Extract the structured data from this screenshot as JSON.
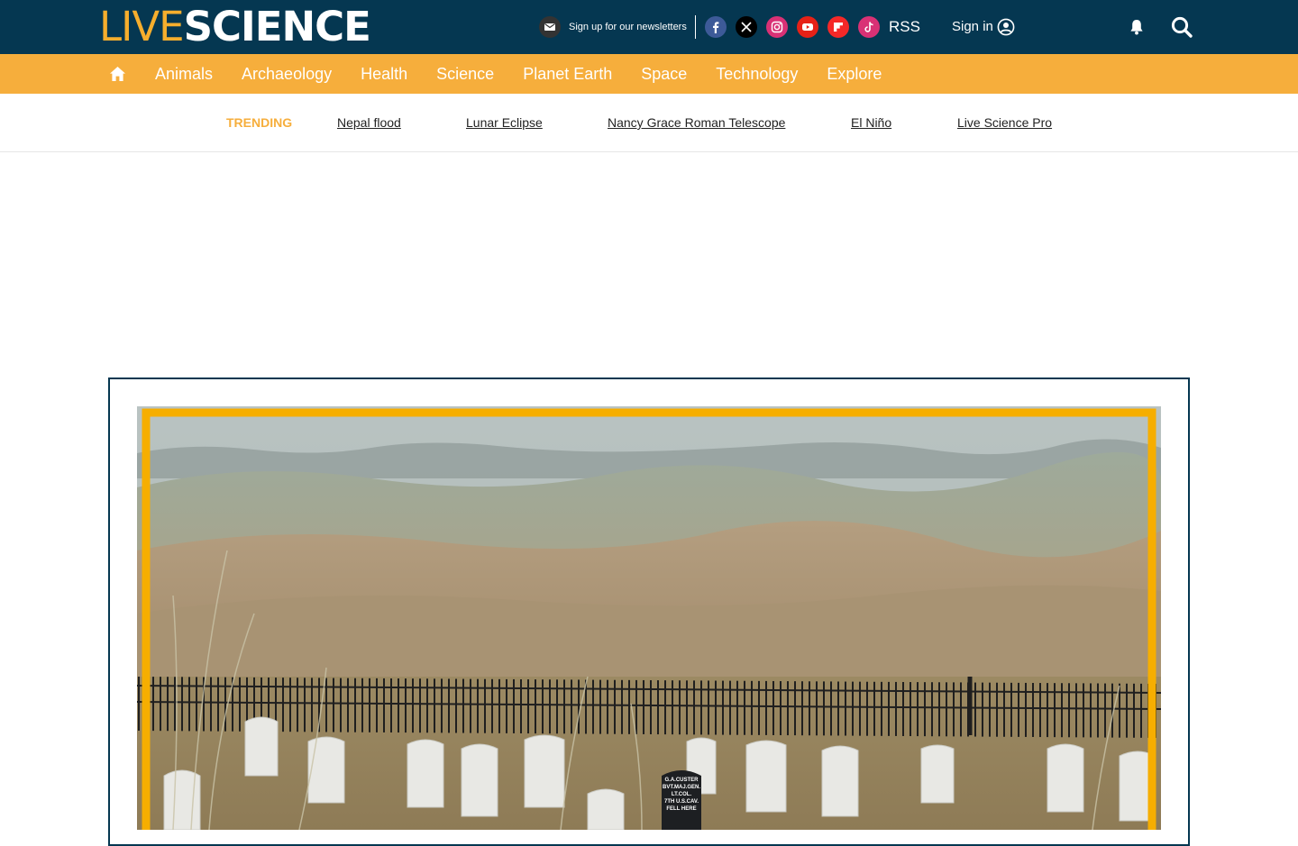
{
  "header": {
    "logo": {
      "live": "LIVE",
      "science": "SCIENCE"
    },
    "newsletter_label": "Sign up for our newsletters",
    "social": [
      {
        "name": "facebook",
        "icon": "facebook-icon"
      },
      {
        "name": "x",
        "icon": "x-icon"
      },
      {
        "name": "instagram",
        "icon": "instagram-icon"
      },
      {
        "name": "youtube",
        "icon": "youtube-icon"
      },
      {
        "name": "flipboard",
        "icon": "flipboard-icon"
      },
      {
        "name": "tiktok",
        "icon": "tiktok-icon"
      }
    ],
    "rss_label": "RSS",
    "signin_label": "Sign in"
  },
  "nav": {
    "items": [
      "Animals",
      "Archaeology",
      "Health",
      "Science",
      "Planet Earth",
      "Space",
      "Technology",
      "Explore"
    ]
  },
  "trending": {
    "label": "TRENDING",
    "links": [
      "Nepal flood",
      "Lunar Eclipse",
      "Nancy Grace Roman Telescope",
      "El Niño",
      "Live Science Pro"
    ]
  },
  "hero_image": {
    "description_icon": "battlefield-cemetery-image",
    "headstone_text": [
      "G.A.CUSTER",
      "BVT.MAJ.GEN.",
      "LT.COL.",
      "7TH U.S.CAV.",
      "FELL HERE"
    ]
  },
  "colors": {
    "header_bg": "#053751",
    "nav_bg": "#f6ae3c",
    "accent": "#f6ae2d",
    "image_frame": "#f6ae00"
  }
}
